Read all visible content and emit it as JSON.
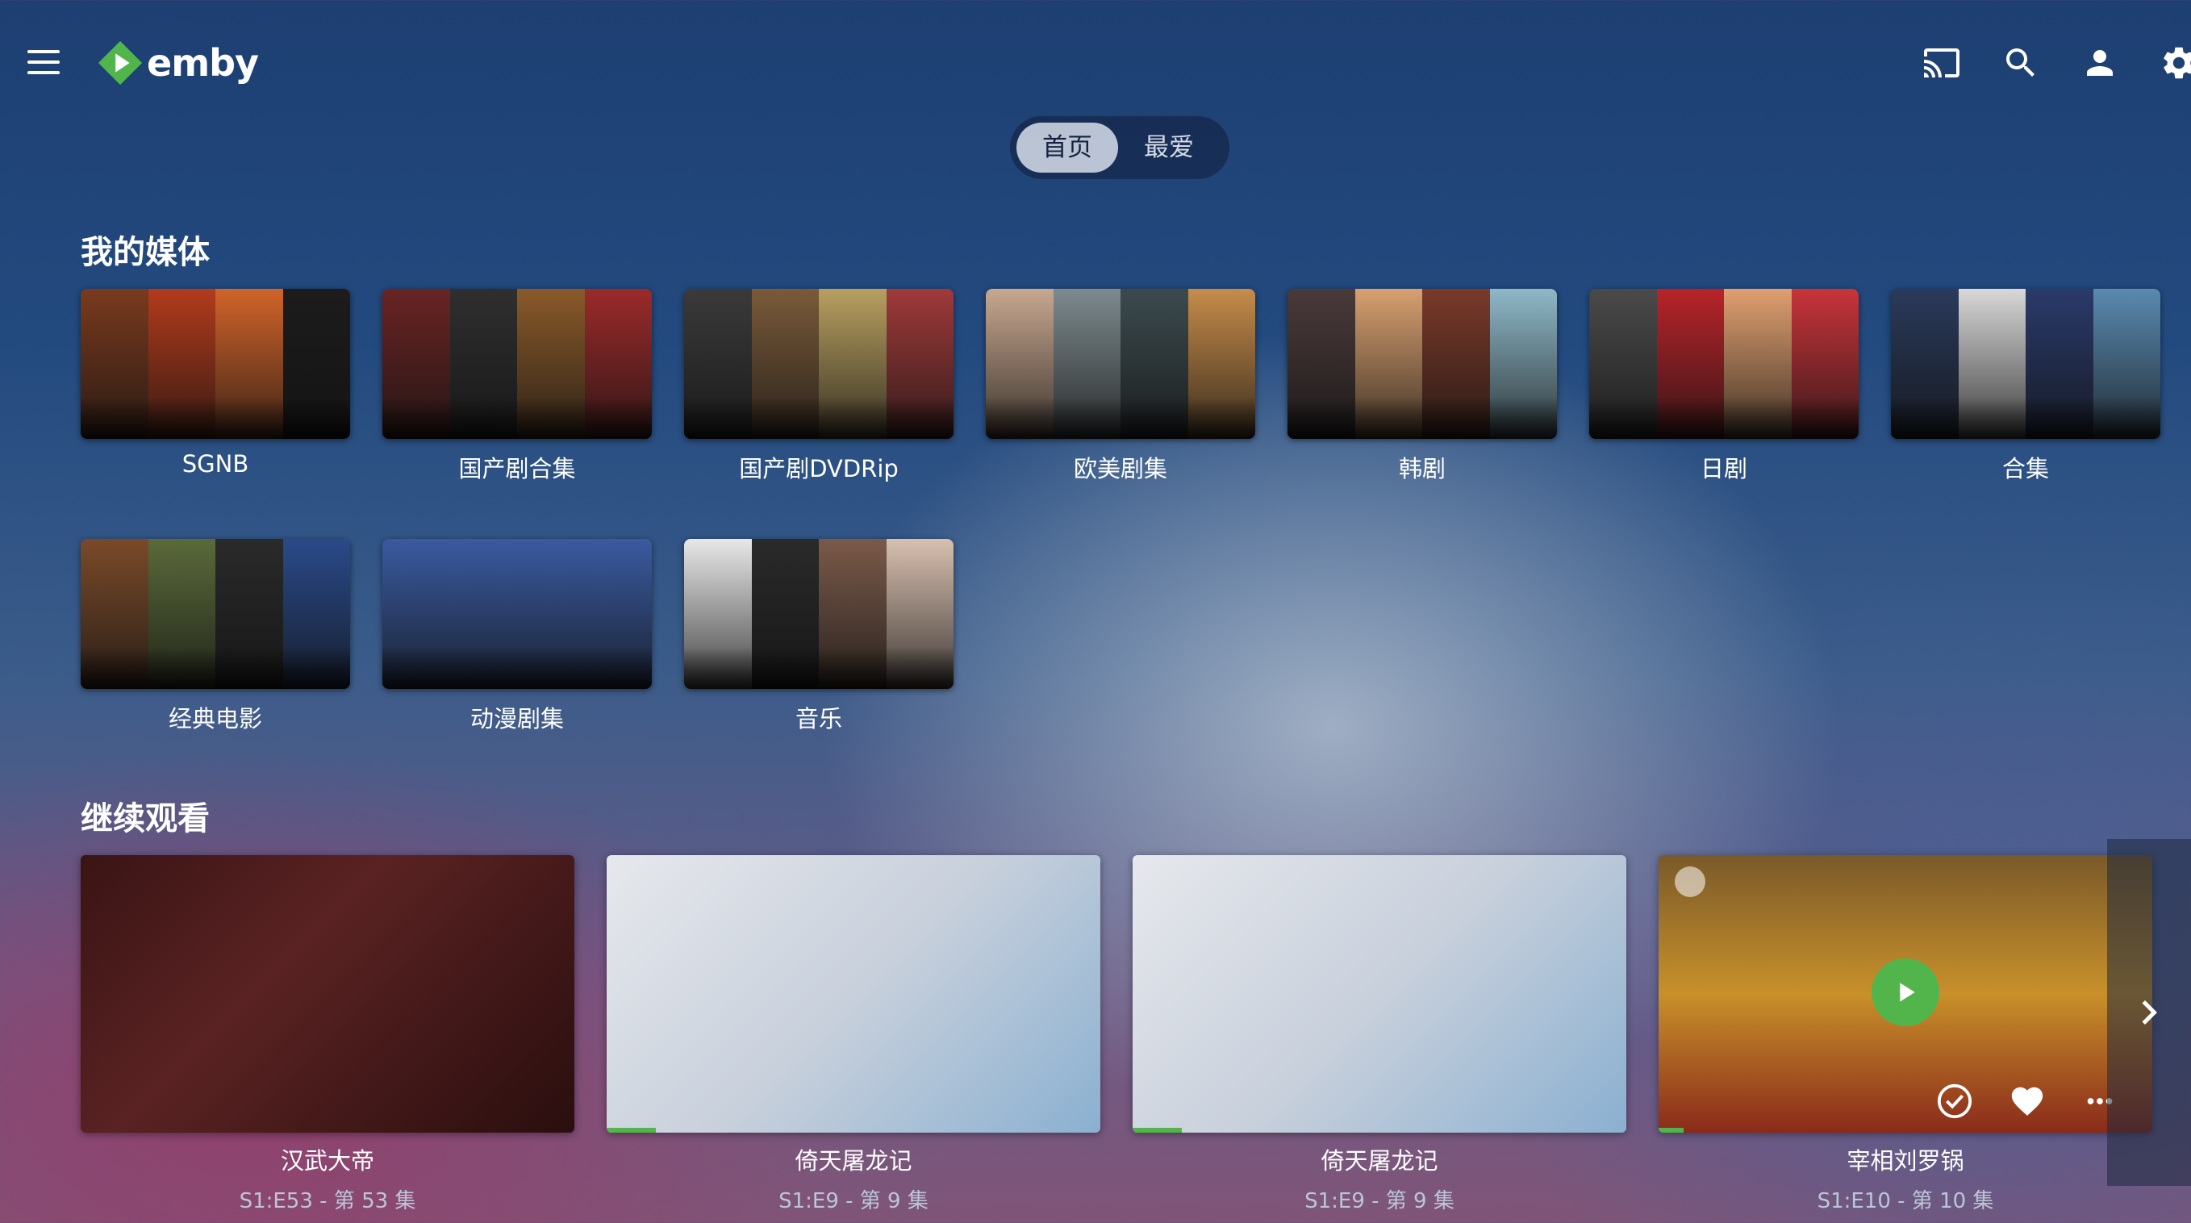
{
  "header": {
    "app_name": "emby",
    "icons": [
      "menu-icon",
      "cast-icon",
      "search-icon",
      "user-icon",
      "settings-icon"
    ]
  },
  "tabs": [
    {
      "label": "首页",
      "active": true
    },
    {
      "label": "最爱",
      "active": false
    }
  ],
  "my_media": {
    "title": "我的媒体",
    "libraries": [
      {
        "label": "SGNB",
        "colors": [
          "#7a3a1e",
          "#b33b1c",
          "#d1642a",
          "#1c1c1c"
        ]
      },
      {
        "label": "国产剧合集",
        "colors": [
          "#6a2424",
          "#2f2f2f",
          "#8a5a2a",
          "#9c2a2a"
        ]
      },
      {
        "label": "国产剧DVDRip",
        "colors": [
          "#3a3a3a",
          "#7a5a3a",
          "#b8a060",
          "#a03a3a"
        ]
      },
      {
        "label": "欧美剧集",
        "colors": [
          "#c8a890",
          "#7d8a8e",
          "#3c4a4e",
          "#c68c4a"
        ]
      },
      {
        "label": "韩剧",
        "colors": [
          "#4a3a3a",
          "#d8a070",
          "#7a3a2a",
          "#8fb8c8"
        ]
      },
      {
        "label": "日剧",
        "colors": [
          "#4a4a4a",
          "#b8242a",
          "#e0a070",
          "#c8343a"
        ]
      },
      {
        "label": "合集",
        "colors": [
          "#2a3a5a",
          "#d8d8d8",
          "#2a3a6a",
          "#5a8ab0"
        ]
      },
      {
        "label": "经典电影",
        "colors": [
          "#7a4a2a",
          "#5a6a3a",
          "#2a2a2a",
          "#2a4a8a"
        ]
      },
      {
        "label": "动漫剧集",
        "colors": [
          "#3a5aa0",
          "#3a5aa0",
          "#3a5aa0",
          "#3a5aa0"
        ]
      },
      {
        "label": "音乐",
        "colors": [
          "#e8e8e8",
          "#2a2a2a",
          "#7a5a4a",
          "#d8c0b0"
        ]
      }
    ]
  },
  "continue_watching": {
    "title": "继续观看",
    "items": [
      {
        "title": "汉武大帝",
        "subtitle": "S1:E53 - 第 53 集",
        "progress": 0,
        "bg": "linear-gradient(135deg,#3a1414 0%,#5a2222 40%,#2a0e0e 100%)"
      },
      {
        "title": "倚天屠龙记",
        "subtitle": "S1:E9 - 第 9 集",
        "progress": 0.1,
        "bg": "linear-gradient(135deg,#e6e8ec 0%,#c8d0dc 50%,#8ab0d0 100%)"
      },
      {
        "title": "倚天屠龙记",
        "subtitle": "S1:E9 - 第 9 集",
        "progress": 0.1,
        "bg": "linear-gradient(135deg,#e6e8ec 0%,#c8d0dc 50%,#8ab0d0 100%)"
      },
      {
        "title": "宰相刘罗锅",
        "subtitle": "S1:E10 - 第 10 集",
        "progress": 0.05,
        "bg": "linear-gradient(180deg,#7a5a2a 0%,#c8902a 50%,#8a2a1a 100%)"
      }
    ]
  }
}
